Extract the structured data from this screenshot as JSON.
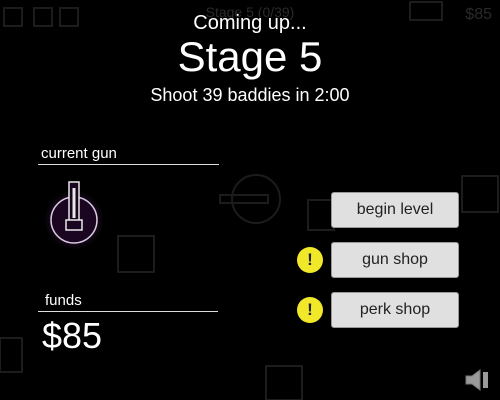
{
  "hud": {
    "stage_progress": "Stage 5 (0/39)",
    "funds": "$85"
  },
  "header": {
    "coming_up": "Coming up...",
    "stage_title": "Stage 5",
    "objective": "Shoot 39 baddies in 2:00"
  },
  "current_gun": {
    "label": "current gun"
  },
  "funds": {
    "label": "funds",
    "value": "$85"
  },
  "menu": {
    "begin_level": "begin level",
    "gun_shop": "gun shop",
    "perk_shop": "perk shop",
    "alert_symbol": "!"
  },
  "colors": {
    "alert": "#f2e82a",
    "button_bg": "#e0e0e0",
    "gun_glow": "#b040c0"
  }
}
